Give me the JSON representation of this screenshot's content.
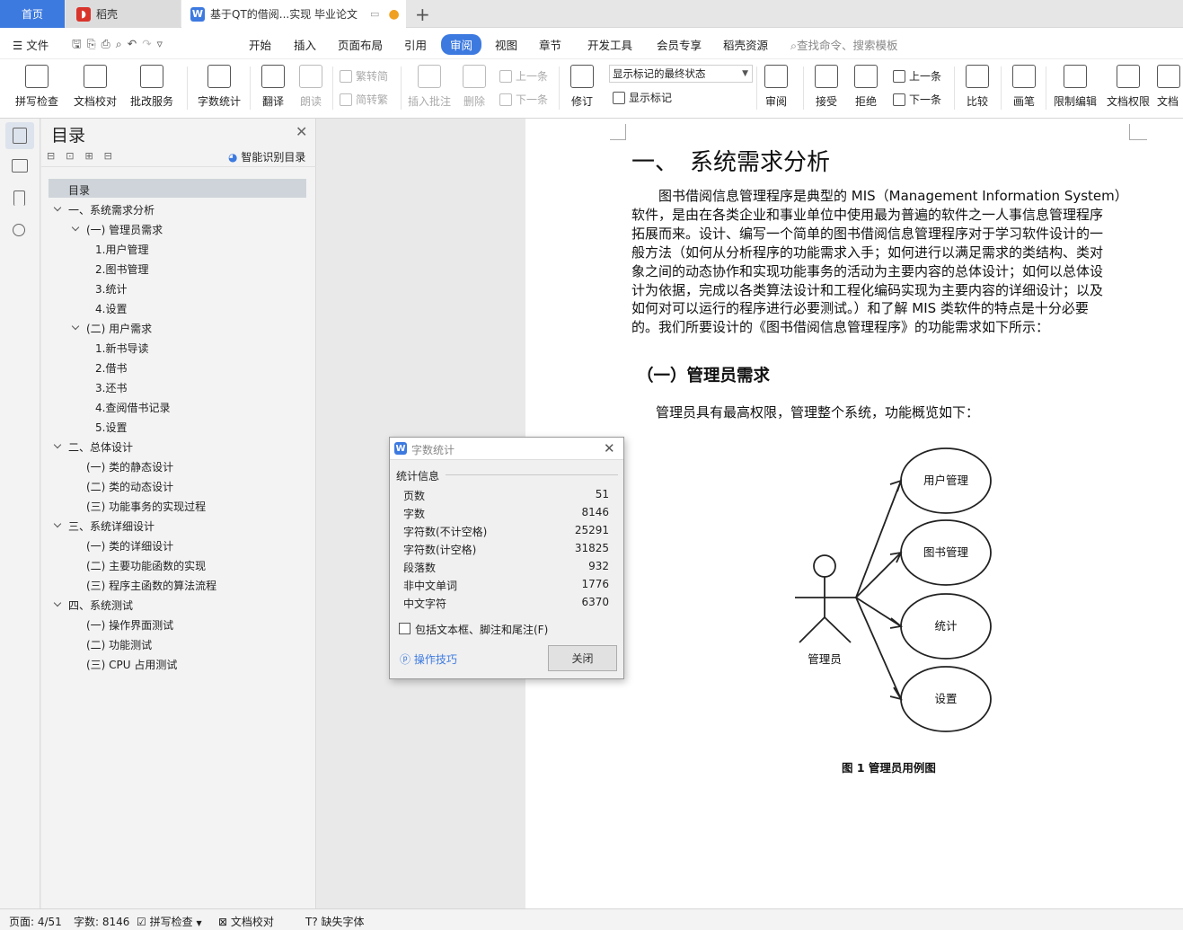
{
  "tabs": {
    "home": "首页",
    "daoke": "稻壳",
    "doc": "基于QT的借阅...实现 毕业论文"
  },
  "menu": {
    "file": "文件",
    "items": [
      "开始",
      "插入",
      "页面布局",
      "引用",
      "审阅",
      "视图",
      "章节",
      "开发工具",
      "会员专享",
      "稻壳资源"
    ],
    "search": "查找命令、搜索模板"
  },
  "ribbon": {
    "spell_check": "拼写检查",
    "doc_proof": "文档校对",
    "review_service": "批改服务",
    "word_count": "字数统计",
    "translate": "翻译",
    "read_aloud": "朗读",
    "trad_to_simp": "繁转简",
    "simp_to_trad": "简转繁",
    "insert_comment": "插入批注",
    "delete": "删除",
    "prev_comment": "上一条",
    "next_comment": "下一条",
    "revise": "修订",
    "markup_mode": "显示标记的最终状态",
    "show_markup": "显示标记",
    "review": "审阅",
    "accept": "接受",
    "reject": "拒绝",
    "prev_change": "上一条",
    "next_change": "下一条",
    "compare": "比较",
    "pen": "画笔",
    "restrict_edit": "限制编辑",
    "doc_permission": "文档权限",
    "doc_more": "文档"
  },
  "toc": {
    "title": "目录",
    "smart": "智能识别目录",
    "root": "目录",
    "items": [
      "一、系统需求分析",
      "(一) 管理员需求",
      "1.用户管理",
      "2.图书管理",
      "3.统计",
      "4.设置",
      "(二) 用户需求",
      "1.新书导读",
      "2.借书",
      "3.还书",
      "4.查阅借书记录",
      "5.设置",
      "二、总体设计",
      "(一) 类的静态设计",
      "(二) 类的动态设计",
      "(三) 功能事务的实现过程",
      "三、系统详细设计",
      "(一) 类的详细设计",
      "(二) 主要功能函数的实现",
      "(三) 程序主函数的算法流程",
      "四、系统测试",
      "(一) 操作界面测试",
      "(二) 功能测试",
      "(三) CPU 占用测试"
    ]
  },
  "document": {
    "heading1": "一、　系统需求分析",
    "para1_lines": [
      "图书借阅信息管理程序是典型的 MIS（Management Information System）",
      "软件，是由在各类企业和事业单位中使用最为普遍的软件之一人事信息管理程序",
      "拓展而来。设计、编写一个简单的图书借阅信息管理程序对于学习软件设计的一",
      "般方法（如何从分析程序的功能需求入手；如何进行以满足需求的类结构、类对",
      "象之间的动态协作和实现功能事务的活动为主要内容的总体设计；如何以总体设",
      "计为依据，完成以各类算法设计和工程化编码实现为主要内容的详细设计；以及",
      "如何对可以运行的程序进行必要测试。）和了解 MIS 类软件的特点是十分必要",
      "的。我们所要设计的《图书借阅信息管理程序》的功能需求如下所示："
    ],
    "heading2": "（一）管理员需求",
    "para2": "管理员具有最高权限，管理整个系统，功能概览如下：",
    "diagram": {
      "actor": "管理员",
      "use_cases": [
        "用户管理",
        "图书管理",
        "统计",
        "设置"
      ]
    },
    "caption": "图 1 管理员用例图"
  },
  "dialog": {
    "title": "字数统计",
    "section": "统计信息",
    "rows": [
      {
        "label": "页数",
        "value": "51"
      },
      {
        "label": "字数",
        "value": "8146"
      },
      {
        "label": "字符数(不计空格)",
        "value": "25291"
      },
      {
        "label": "字符数(计空格)",
        "value": "31825"
      },
      {
        "label": "段落数",
        "value": "932"
      },
      {
        "label": "非中文单词",
        "value": "1776"
      },
      {
        "label": "中文字符",
        "value": "6370"
      }
    ],
    "checkbox": "包括文本框、脚注和尾注(F)",
    "tips": "操作技巧",
    "close": "关闭"
  },
  "status": {
    "page": "页面: 4/51",
    "words": "字数: 8146",
    "spell": "拼写检查",
    "proof": "文档校对",
    "font": "缺失字体"
  },
  "colors": {
    "accent": "#3d7ae0",
    "daoke_red": "#d9342b"
  }
}
